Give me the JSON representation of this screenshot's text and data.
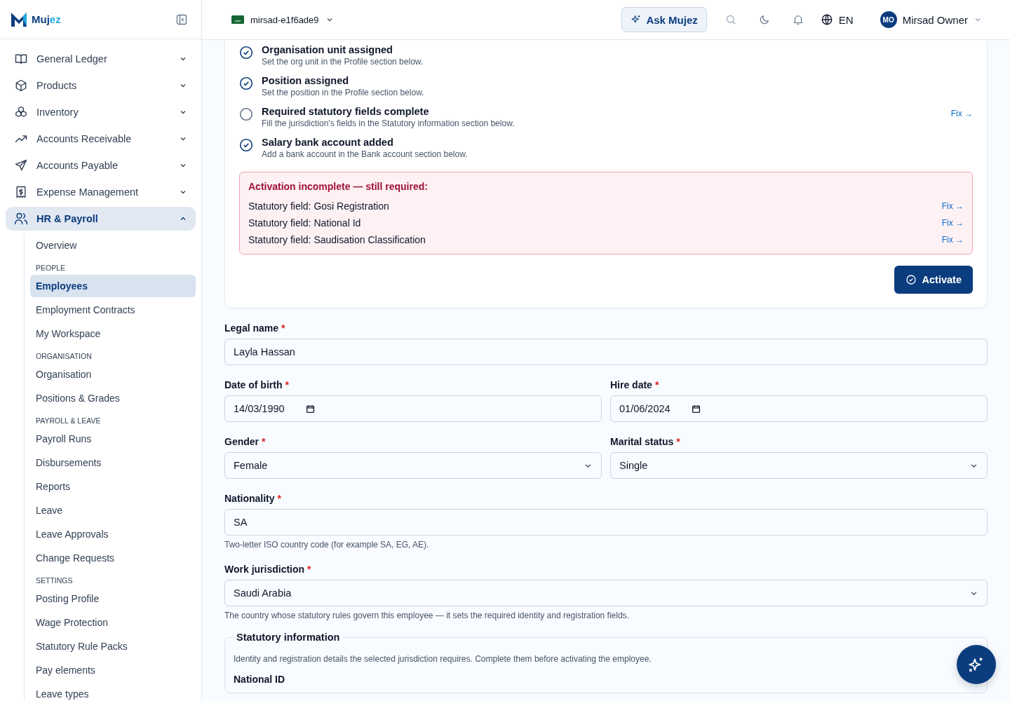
{
  "sidebar": {
    "brand": {
      "part_1": "Muj",
      "part_2": "ez"
    },
    "nav": [
      {
        "label": "General Ledger",
        "expanded": false,
        "selected": false
      },
      {
        "label": "Products",
        "expanded": false,
        "selected": false
      },
      {
        "label": "Inventory",
        "expanded": false,
        "selected": false
      },
      {
        "label": "Accounts Receivable",
        "expanded": false,
        "selected": false
      },
      {
        "label": "Accounts Payable",
        "expanded": false,
        "selected": false
      },
      {
        "label": "Expense Management",
        "expanded": false,
        "selected": false
      },
      {
        "label": "HR & Payroll",
        "expanded": true,
        "selected": true,
        "children": [
          {
            "kind": "link",
            "label": "Overview",
            "selected": false
          },
          {
            "kind": "heading",
            "label": "PEOPLE"
          },
          {
            "kind": "link",
            "label": "Employees",
            "selected": true
          },
          {
            "kind": "link",
            "label": "Employment Contracts",
            "selected": false
          },
          {
            "kind": "link",
            "label": "My Workspace",
            "selected": false
          },
          {
            "kind": "heading",
            "label": "ORGANISATION"
          },
          {
            "kind": "link",
            "label": "Organisation",
            "selected": false
          },
          {
            "kind": "link",
            "label": "Positions & Grades",
            "selected": false
          },
          {
            "kind": "heading",
            "label": "PAYROLL & LEAVE"
          },
          {
            "kind": "link",
            "label": "Payroll Runs",
            "selected": false
          },
          {
            "kind": "link",
            "label": "Disbursements",
            "selected": false
          },
          {
            "kind": "link",
            "label": "Reports",
            "selected": false
          },
          {
            "kind": "link",
            "label": "Leave",
            "selected": false
          },
          {
            "kind": "link",
            "label": "Leave Approvals",
            "selected": false
          },
          {
            "kind": "link",
            "label": "Change Requests",
            "selected": false
          },
          {
            "kind": "heading",
            "label": "SETTINGS"
          },
          {
            "kind": "link",
            "label": "Posting Profile",
            "selected": false
          },
          {
            "kind": "link",
            "label": "Wage Protection",
            "selected": false
          },
          {
            "kind": "link",
            "label": "Statutory Rule Packs",
            "selected": false
          },
          {
            "kind": "link",
            "label": "Pay elements",
            "selected": false
          },
          {
            "kind": "link",
            "label": "Leave types",
            "selected": false
          }
        ]
      }
    ]
  },
  "header": {
    "workspace": "mirsad-e1f6ade9",
    "ask_button": "Ask Mujez",
    "language": "EN",
    "avatar_initials": "MO",
    "user_name": "Mirsad Owner"
  },
  "checklist": [
    {
      "title": "Organisation unit assigned",
      "hint": "Set the org unit in the Profile section below.",
      "done": true
    },
    {
      "title": "Position assigned",
      "hint": "Set the position in the Profile section below.",
      "done": true
    },
    {
      "title": "Required statutory fields complete",
      "hint": "Fill the jurisdiction's fields in the Statutory information section below.",
      "done": false,
      "action": "Fix →"
    },
    {
      "title": "Salary bank account added",
      "hint": "Add a bank account in the Bank account section below.",
      "done": true
    }
  ],
  "alert": {
    "title": "Activation incomplete — still required:",
    "items": [
      {
        "text": "Statutory field: Gosi Registration",
        "action": "Fix →"
      },
      {
        "text": "Statutory field: National Id",
        "action": "Fix →"
      },
      {
        "text": "Statutory field: Saudisation Classification",
        "action": "Fix →"
      }
    ]
  },
  "activate_button": "Activate",
  "form_rows": [
    [
      {
        "kind": "text",
        "label": "Legal name",
        "required_mark": "*",
        "value": "Layla Hassan"
      }
    ],
    [
      {
        "kind": "date",
        "label": "Date of birth",
        "required_mark": "*",
        "value": "14/03/1990"
      },
      {
        "kind": "date",
        "label": "Hire date",
        "required_mark": "*",
        "value": "01/06/2024"
      }
    ],
    [
      {
        "kind": "select",
        "label": "Gender",
        "required_mark": "*",
        "value": "Female"
      },
      {
        "kind": "select",
        "label": "Marital status",
        "required_mark": "*",
        "value": "Single"
      }
    ],
    [
      {
        "kind": "text",
        "label": "Nationality",
        "required_mark": "*",
        "value": "SA",
        "help": "Two-letter ISO country code (for example SA, EG, AE)."
      }
    ],
    [
      {
        "kind": "select",
        "label": "Work jurisdiction",
        "required_mark": "*",
        "value": "Saudi Arabia",
        "help": "The country whose statutory rules govern this employee — it sets the required identity and registration fields."
      }
    ]
  ],
  "statutory": {
    "legend": "Statutory information",
    "description": "Identity and registration details the selected jurisdiction requires. Complete them before activating the employee.",
    "first_field_label": "National ID"
  }
}
